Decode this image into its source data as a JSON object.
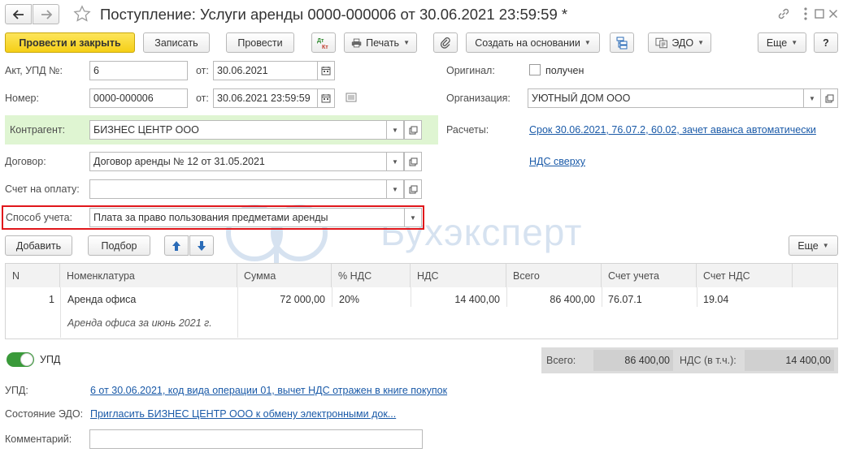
{
  "window": {
    "title": "Поступление: Услуги аренды 0000-000006 от 30.06.2021 23:59:59 *",
    "icons": [
      "back-arrow-icon",
      "forward-arrow-icon",
      "star-icon",
      "link-icon",
      "more-vertical-icon",
      "maximize-icon",
      "close-icon"
    ]
  },
  "toolbar": {
    "post_close": "Провести и закрыть",
    "save": "Записать",
    "post": "Провести",
    "dtkt": "Дт Кт",
    "print": "Печать",
    "create_based": "Создать на основании",
    "edo": "ЭДО",
    "more": "Еще",
    "help": "?"
  },
  "form": {
    "act_label": "Акт, УПД №:",
    "act_value": "6",
    "from_label": "от:",
    "act_date": "30.06.2021",
    "number_label": "Номер:",
    "number_value": "0000-000006",
    "number_date": "30.06.2021 23:59:59",
    "original_label": "Оригинал:",
    "original_checkbox": "получен",
    "org_label": "Организация:",
    "org_value": "УЮТНЫЙ ДОМ ООО",
    "contractor_label": "Контрагент:",
    "contractor_value": "БИЗНЕС ЦЕНТР ООО",
    "settlements_label": "Расчеты:",
    "settlements_link": "Срок 30.06.2021, 76.07.2, 60.02, зачет аванса автоматически",
    "contract_label": "Договор:",
    "contract_value": "Договор аренды № 12 от 31.05.2021",
    "vat_link": "НДС сверху",
    "invoice_label": "Счет на оплату:",
    "invoice_value": "",
    "accounting_label": "Способ учета:",
    "accounting_value": "Плата за право пользования предметами аренды"
  },
  "watermark": {
    "text": "Бухэксперт"
  },
  "table_toolbar": {
    "add": "Добавить",
    "select": "Подбор",
    "more": "Еще"
  },
  "table": {
    "columns": [
      "N",
      "Номенклатура",
      "Сумма",
      "% НДС",
      "НДС",
      "Всего",
      "Счет учета",
      "Счет НДС"
    ],
    "rows": [
      {
        "n": "1",
        "item": "Аренда офиса",
        "item_desc": "Аренда офиса за июнь 2021 г.",
        "sum": "72 000,00",
        "vat_rate": "20%",
        "vat": "14 400,00",
        "total": "86 400,00",
        "account": "76.07.1",
        "vat_account": "19.04"
      }
    ]
  },
  "footer": {
    "upd_toggle": "УПД",
    "total_label": "Всего:",
    "total_value": "86 400,00",
    "vat_label": "НДС (в т.ч.):",
    "vat_value": "14 400,00",
    "upd_label": "УПД:",
    "upd_link": "6 от 30.06.2021, код вида операции 01, вычет НДС отражен в книге покупок",
    "edo_label": "Состояние ЭДО:",
    "edo_link": "Пригласить БИЗНЕС ЦЕНТР ООО к обмену электронными док...",
    "comment_label": "Комментарий:",
    "comment_value": ""
  },
  "colors": {
    "accent_yellow": "#f5cf16",
    "link_blue": "#1a5aa8",
    "contractor_highlight": "#dff5d2",
    "accounting_border": "#e0161b",
    "toggle_green": "#3a9a3a",
    "totals_bg": "#dcdcdc"
  }
}
